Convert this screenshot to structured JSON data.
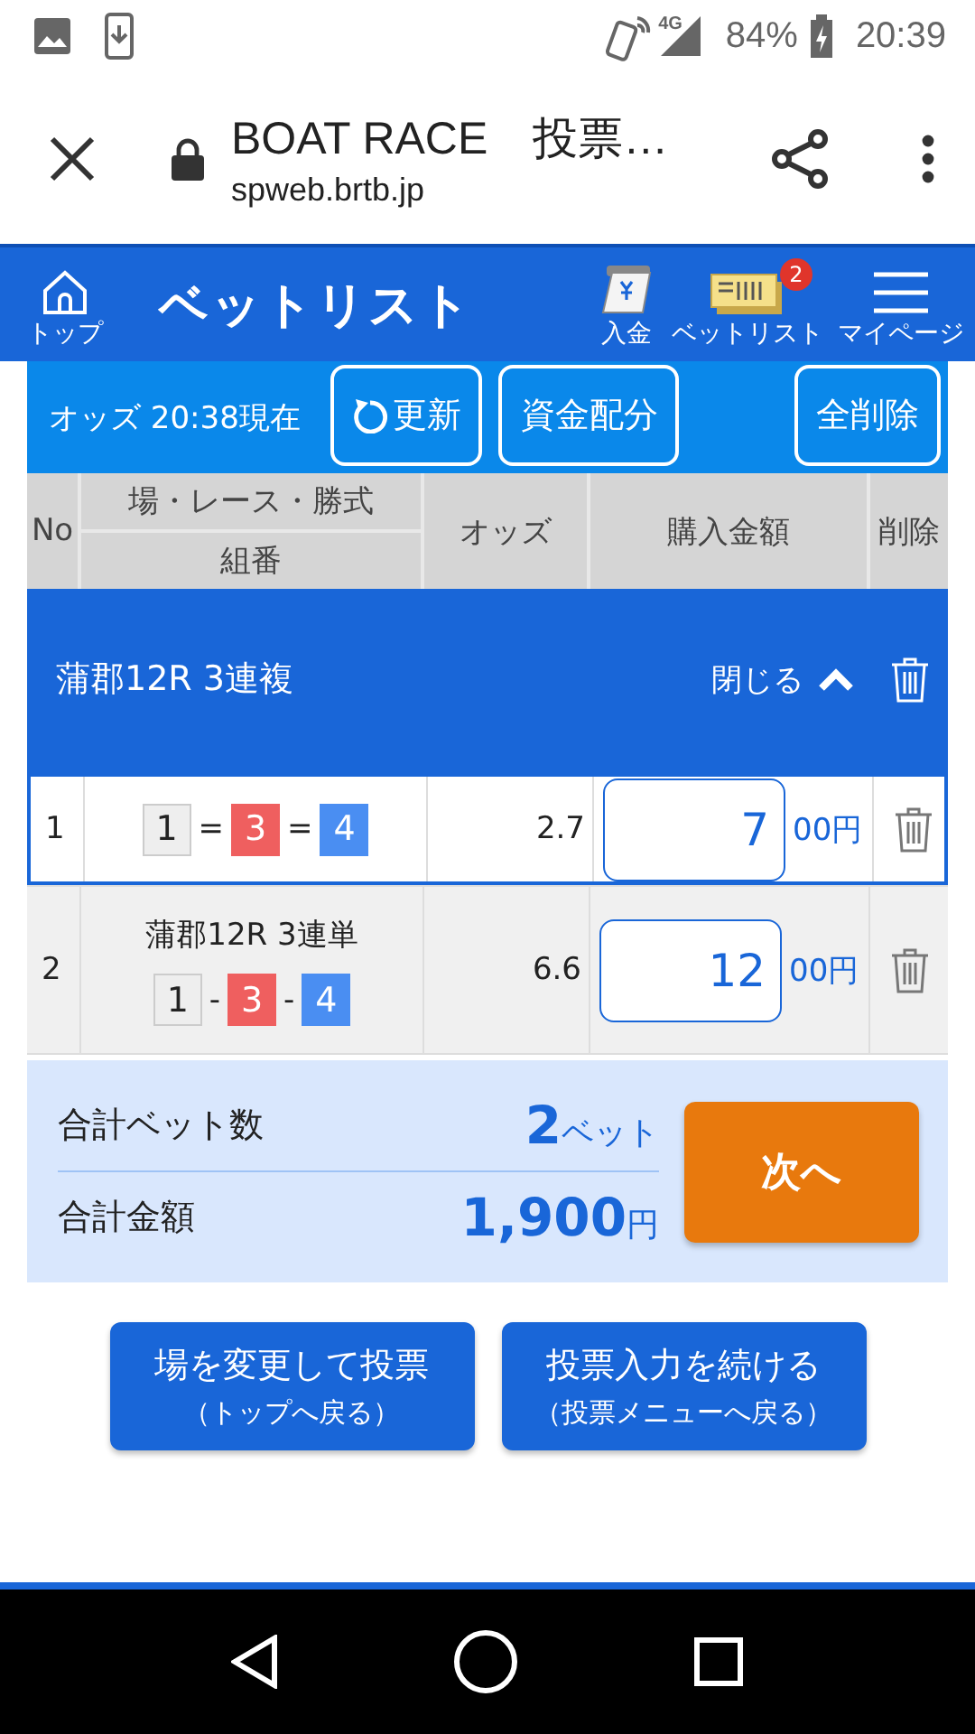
{
  "status_bar": {
    "network": "4G",
    "battery": "84%",
    "time": "20:39"
  },
  "browser": {
    "title": "BOAT RACE　投票…",
    "url": "spweb.brtb.jp"
  },
  "header": {
    "home_label": "トップ",
    "title": "ベットリスト",
    "actions": [
      {
        "kind": "deposit",
        "label": "入金"
      },
      {
        "kind": "betlist",
        "label": "ベットリスト",
        "badge": "2"
      },
      {
        "kind": "menu",
        "label": "マイページ"
      }
    ]
  },
  "toolbar": {
    "odds_time": "オッズ 20:38現在",
    "buttons": [
      {
        "kind": "refresh",
        "label": "更新"
      },
      {
        "kind": "plain",
        "label": "資金配分"
      },
      {
        "kind": "spaced",
        "label": "全削除"
      }
    ]
  },
  "table": {
    "columns": [
      {
        "label": "No"
      },
      {
        "label": "場・レース・勝式",
        "sub": "組番"
      },
      {
        "label": "オッズ"
      },
      {
        "label": "購入金額"
      },
      {
        "label": "削除"
      }
    ],
    "group": {
      "title": "蒲郡12R 3連複",
      "toggle": "閉じる",
      "expanded": true
    },
    "rows": [
      {
        "no": "1",
        "selected": true,
        "combo": [
          {
            "kind": "boat",
            "label": "1",
            "color": "#eeeeee"
          },
          {
            "kind": "sep",
            "label": "="
          },
          {
            "kind": "boat",
            "label": "3",
            "color": "#ef5f5f"
          },
          {
            "kind": "sep",
            "label": "="
          },
          {
            "kind": "boat",
            "label": "4",
            "color": "#4a8ef2"
          }
        ],
        "odds": "2.7",
        "amount": "7",
        "unit": "00円"
      },
      {
        "no": "2",
        "selected": false,
        "race": "蒲郡12R 3連単",
        "combo": [
          {
            "kind": "boat",
            "label": "1",
            "color": "#eeeeee"
          },
          {
            "kind": "sep",
            "label": "-"
          },
          {
            "kind": "boat",
            "label": "3",
            "color": "#ef5f5f"
          },
          {
            "kind": "sep",
            "label": "-"
          },
          {
            "kind": "boat",
            "label": "4",
            "color": "#4a8ef2"
          }
        ],
        "odds": "6.6",
        "amount": "12",
        "unit": "00円"
      }
    ]
  },
  "summary": {
    "rows": [
      {
        "label": "合計ベット数",
        "value": "2",
        "unit": "ベット"
      },
      {
        "label": "合計金額",
        "value": "1,900",
        "unit": "円"
      }
    ],
    "next_button": "次へ"
  },
  "bottom_buttons": [
    {
      "label": "場を変更して投票",
      "sub": "（トップへ戻る）"
    },
    {
      "label": "投票入力を続ける",
      "sub": "（投票メニューへ戻る）"
    }
  ]
}
